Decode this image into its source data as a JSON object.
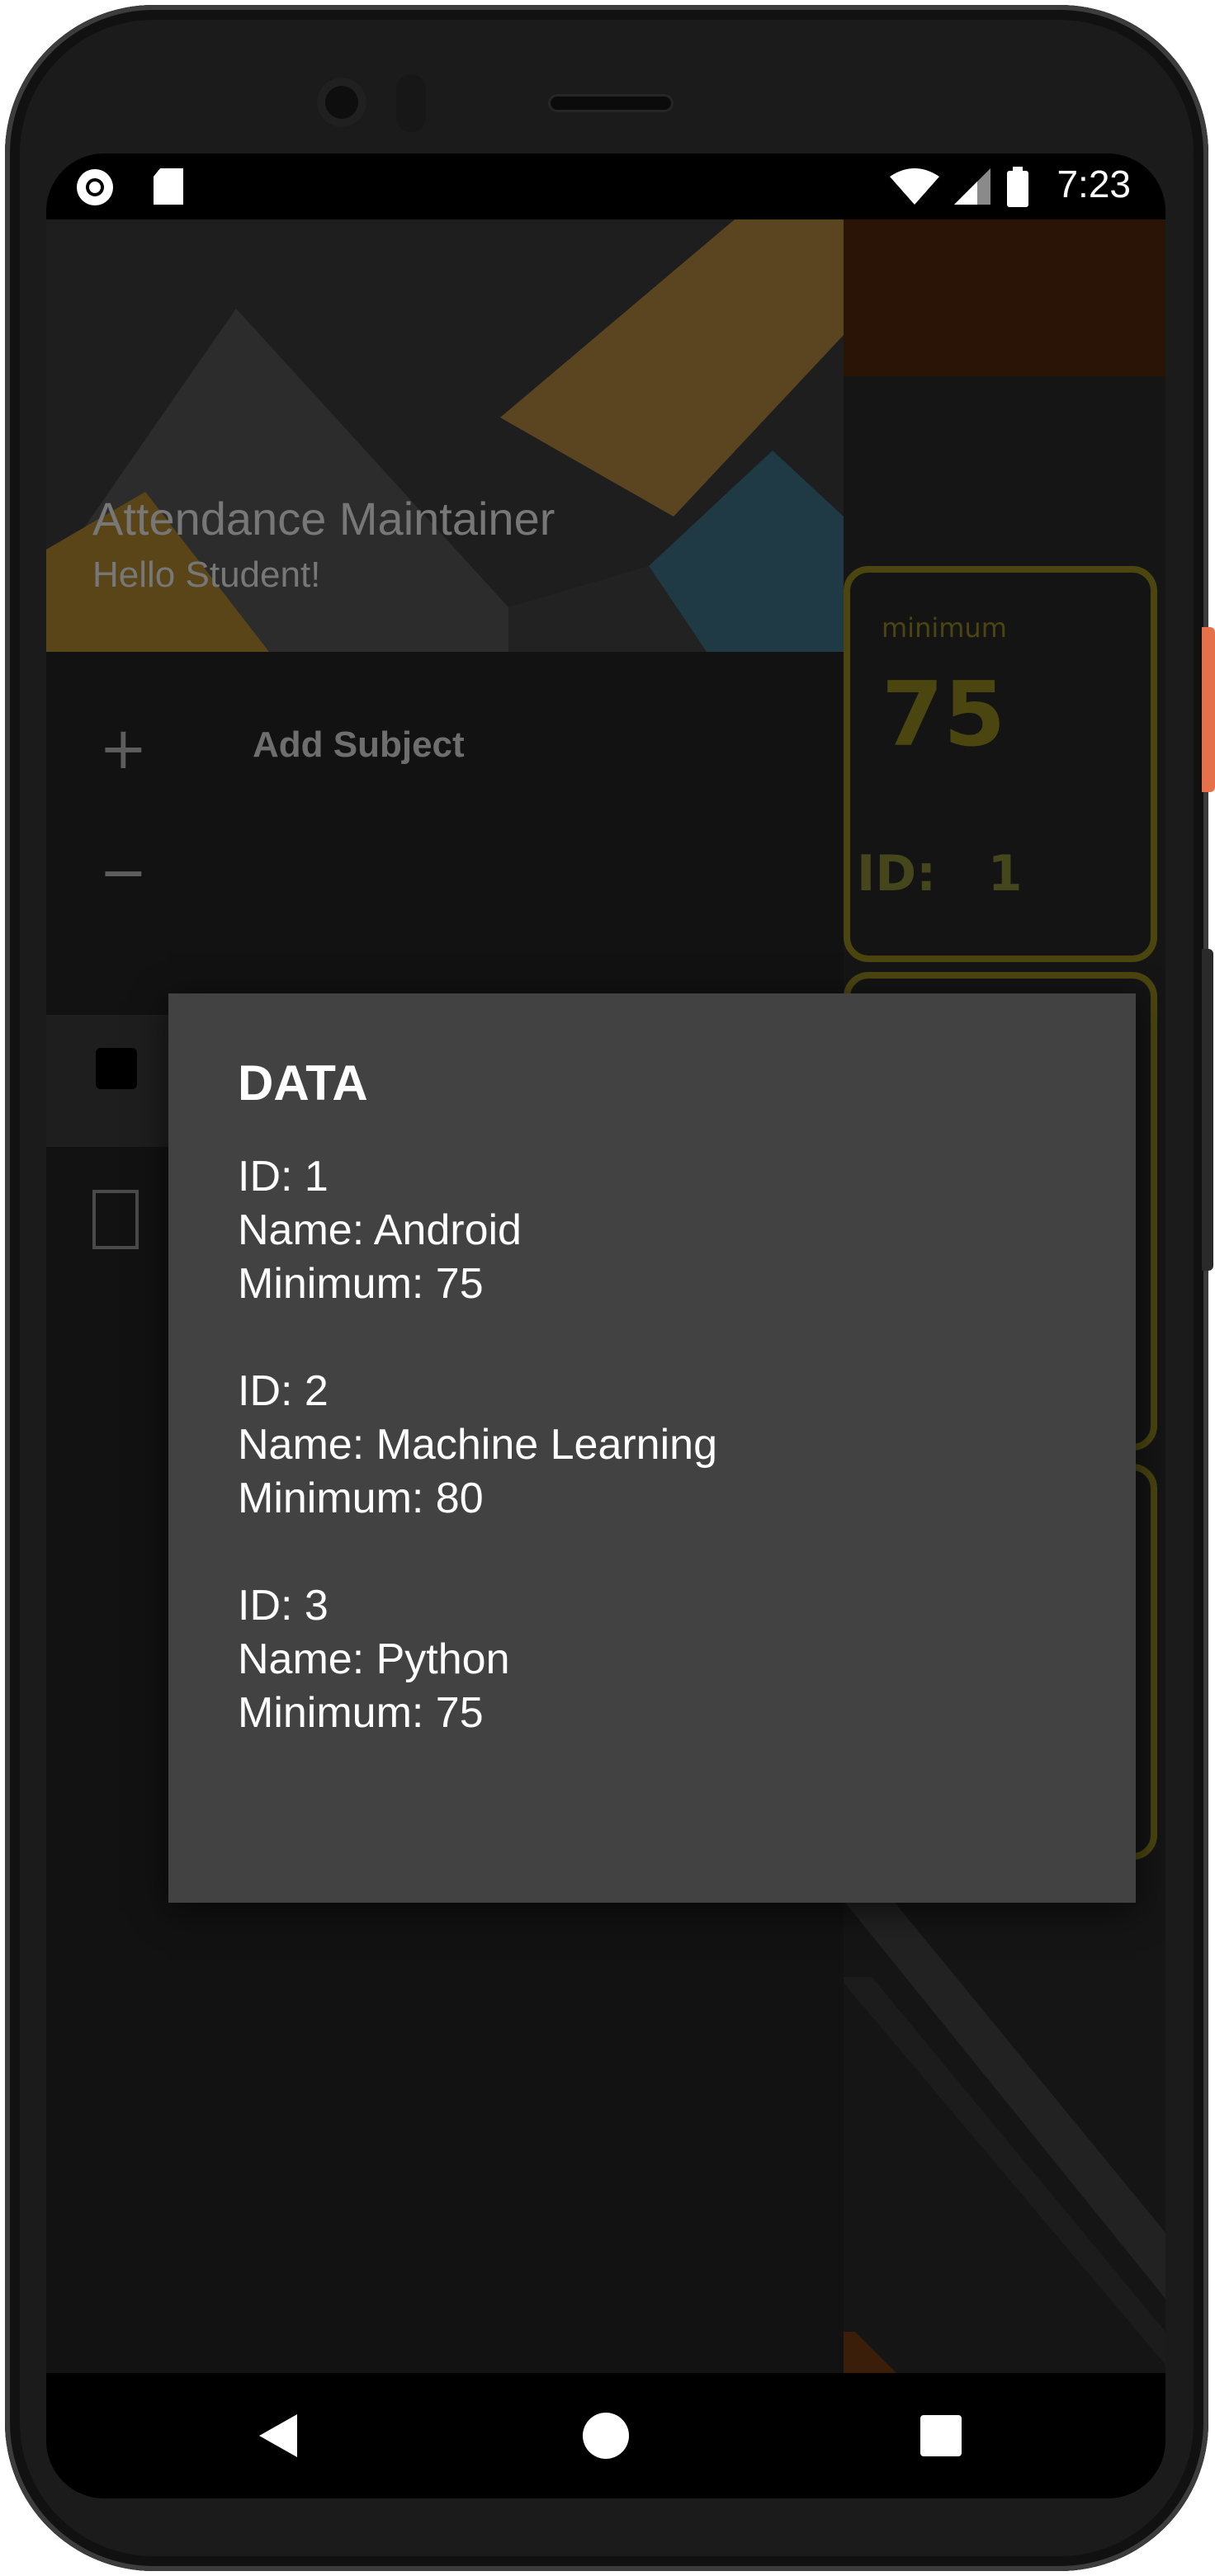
{
  "status_bar": {
    "time": "7:23",
    "icons": [
      "record-icon",
      "sd-card-icon",
      "wifi-icon",
      "signal-icon",
      "battery-icon"
    ]
  },
  "drawer": {
    "title": "Attendance Maintainer",
    "subtitle": "Hello Student!",
    "items": [
      {
        "icon": "plus-icon",
        "label": "Add Subject"
      }
    ]
  },
  "background_card": {
    "minimum_label": "minimum",
    "minimum_value": "75",
    "id_label": "ID:",
    "id_value": "1"
  },
  "dialog": {
    "title": "DATA",
    "records": [
      {
        "id": "ID: 1",
        "name": "Name: Android",
        "minimum": "Minimum: 75"
      },
      {
        "id": "ID: 2",
        "name": "Name: Machine Learning",
        "minimum": "Minimum: 80"
      },
      {
        "id": "ID: 3",
        "name": "Name: Python",
        "minimum": "Minimum: 75"
      }
    ]
  },
  "colors": {
    "dialog_bg": "#424242",
    "accent_orange": "#e6704a",
    "card_border": "#4b4510"
  }
}
